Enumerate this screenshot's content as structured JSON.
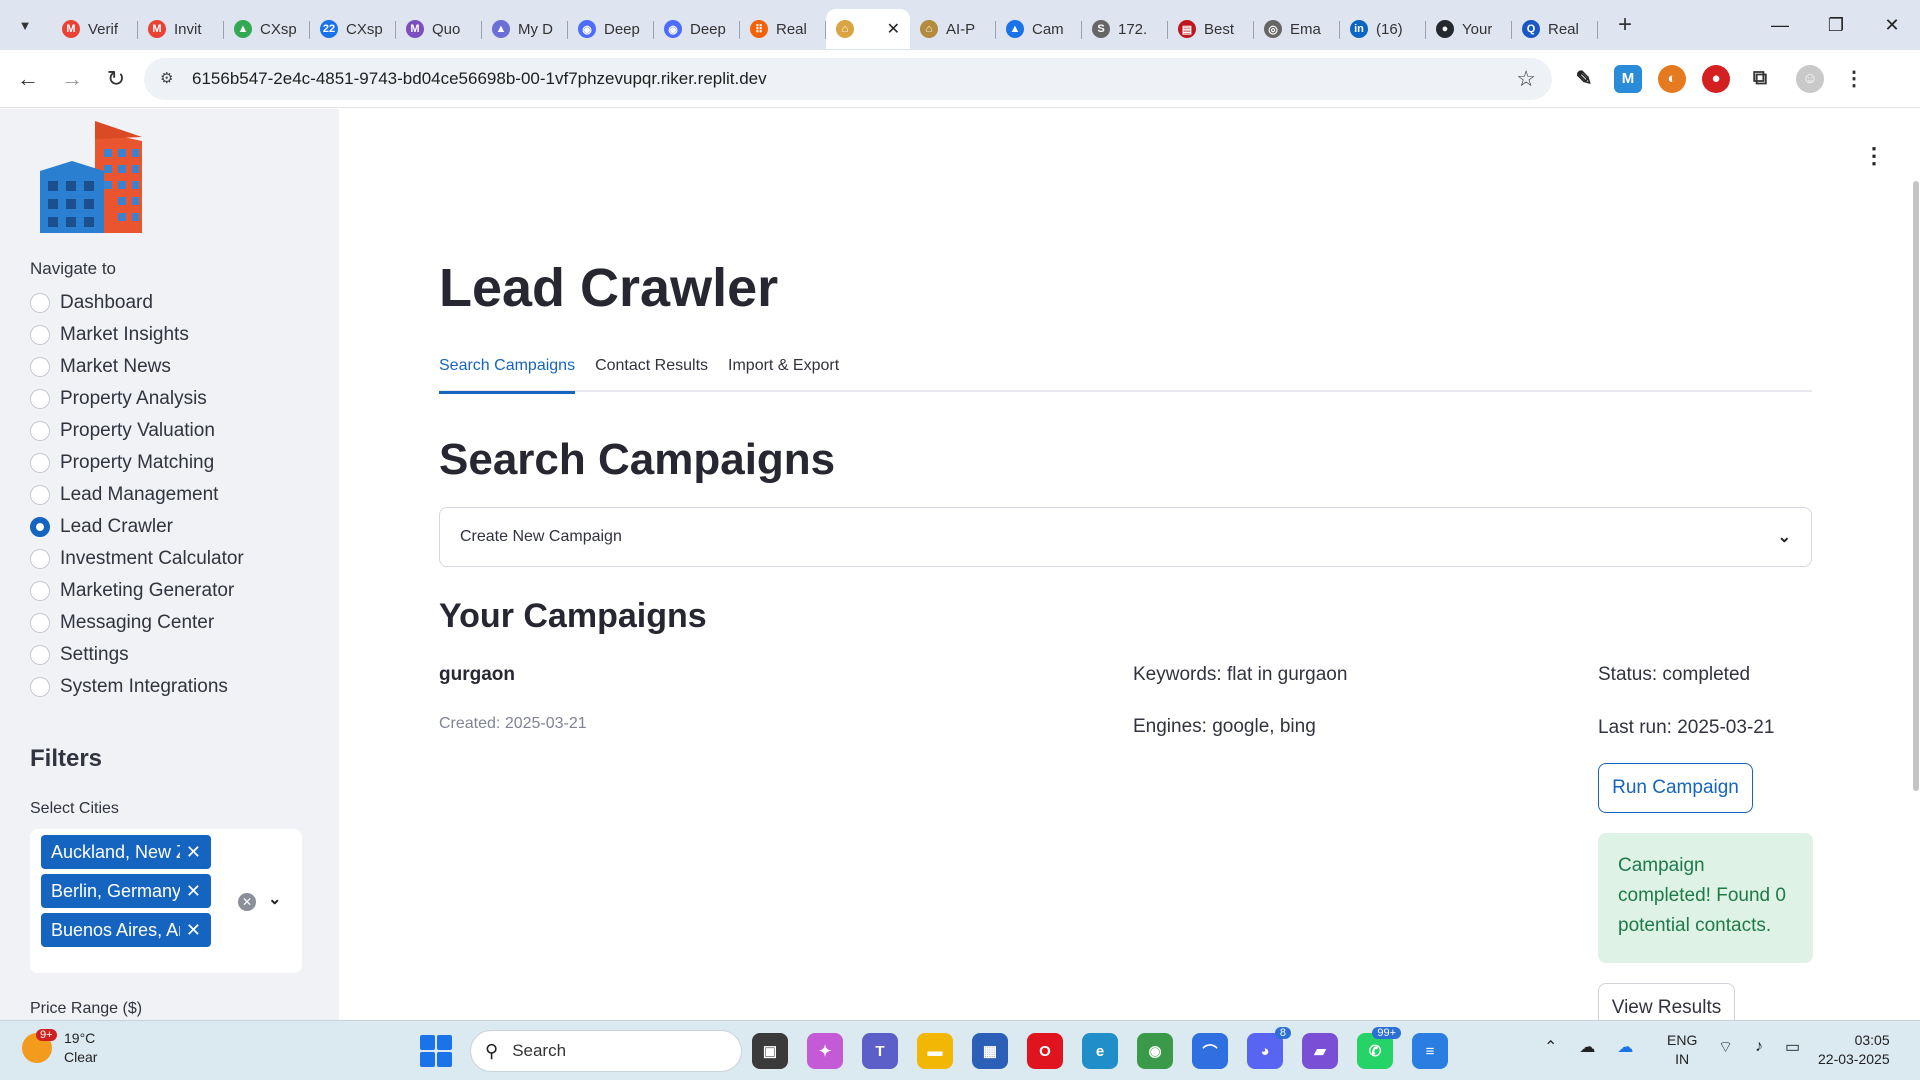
{
  "browser": {
    "tabs": [
      {
        "title": "Verif",
        "icon": "gmail-icon",
        "color": "#ea4335",
        "glyph": "M"
      },
      {
        "title": "Invit",
        "icon": "gmail-icon",
        "color": "#ea4335",
        "glyph": "M"
      },
      {
        "title": "CXsp",
        "icon": "drive-icon",
        "color": "#34a853",
        "glyph": "▲"
      },
      {
        "title": "CXsp",
        "icon": "calendar-icon",
        "color": "#1a73e8",
        "glyph": "22"
      },
      {
        "title": "Quo",
        "icon": "gmail-icon",
        "color": "#7b4fbf",
        "glyph": "M"
      },
      {
        "title": "My D",
        "icon": "drive-icon",
        "color": "#6b6fd6",
        "glyph": "▲"
      },
      {
        "title": "Deep",
        "icon": "deepseek-icon",
        "color": "#4d6bfe",
        "glyph": "◉"
      },
      {
        "title": "Deep",
        "icon": "deepseek-icon",
        "color": "#4d6bfe",
        "glyph": "◉"
      },
      {
        "title": "Real",
        "icon": "replit-icon",
        "color": "#f26207",
        "glyph": "⠿"
      },
      {
        "title": "",
        "icon": "house-icon",
        "color": "#d9a441",
        "glyph": "⌂"
      },
      {
        "title": "AI-P",
        "icon": "house-icon",
        "color": "#b48a3c",
        "glyph": "⌂"
      },
      {
        "title": "Cam",
        "icon": "ads-icon",
        "color": "#1a73e8",
        "glyph": "▲"
      },
      {
        "title": "172.",
        "icon": "globe-icon",
        "color": "#666666",
        "glyph": "S"
      },
      {
        "title": "Best",
        "icon": "news-icon",
        "color": "#c0161d",
        "glyph": "▤"
      },
      {
        "title": "Ema",
        "icon": "globe-icon",
        "color": "#666666",
        "glyph": "◎"
      },
      {
        "title": "(16)",
        "icon": "linkedin-icon",
        "color": "#0a66c2",
        "glyph": "in"
      },
      {
        "title": "Your",
        "icon": "github-icon",
        "color": "#24292f",
        "glyph": "●"
      },
      {
        "title": "Real",
        "icon": "search-engine-icon",
        "color": "#1a57c6",
        "glyph": "Q"
      }
    ],
    "active_tab_index": 9,
    "new_tab": "+",
    "url": "6156b547-2e4c-4851-9743-bd04ce56698b-00-1vf7phzevupqr.riker.replit.dev"
  },
  "sidebar": {
    "nav_label": "Navigate to",
    "nav_items": [
      {
        "label": "Dashboard",
        "selected": false
      },
      {
        "label": "Market Insights",
        "selected": false
      },
      {
        "label": "Market News",
        "selected": false
      },
      {
        "label": "Property Analysis",
        "selected": false
      },
      {
        "label": "Property Valuation",
        "selected": false
      },
      {
        "label": "Property Matching",
        "selected": false
      },
      {
        "label": "Lead Management",
        "selected": false
      },
      {
        "label": "Lead Crawler",
        "selected": true
      },
      {
        "label": "Investment Calculator",
        "selected": false
      },
      {
        "label": "Marketing Generator",
        "selected": false
      },
      {
        "label": "Messaging Center",
        "selected": false
      },
      {
        "label": "Settings",
        "selected": false
      },
      {
        "label": "System Integrations",
        "selected": false
      }
    ],
    "filters_title": "Filters",
    "cities_label": "Select Cities",
    "cities": [
      "Auckland, New Zealand",
      "Berlin, Germany",
      "Buenos Aires, Argentina"
    ],
    "price_label": "Price Range ($)"
  },
  "main": {
    "title": "Lead Crawler",
    "tabs": [
      {
        "label": "Search Campaigns",
        "active": true
      },
      {
        "label": "Contact Results",
        "active": false
      },
      {
        "label": "Import & Export",
        "active": false
      }
    ],
    "section_title": "Search Campaigns",
    "expander_label": "Create New Campaign",
    "your_campaigns_title": "Your Campaigns",
    "campaign": {
      "name": "gurgaon",
      "created": "Created: 2025-03-21",
      "keywords": "Keywords: flat in gurgaon",
      "engines": "Engines: google, bing",
      "status": "Status: completed",
      "last_run": "Last run: 2025-03-21",
      "run_button": "Run Campaign",
      "success_message": "Campaign completed! Found 0 potential contacts.",
      "view_button": "View Results"
    }
  },
  "taskbar": {
    "temperature": "19°C",
    "weather": "Clear",
    "weather_badge": "9+",
    "search_placeholder": "Search",
    "apps": [
      {
        "icon": "task-view-icon",
        "color": "#3a3a3a",
        "glyph": "▣",
        "badge": ""
      },
      {
        "icon": "copilot-icon",
        "color": "#c45ad6",
        "glyph": "✦",
        "badge": ""
      },
      {
        "icon": "teams-icon",
        "color": "#5b5fc7",
        "glyph": "T",
        "badge": ""
      },
      {
        "icon": "file-explorer-icon",
        "color": "#f2b705",
        "glyph": "▬",
        "badge": ""
      },
      {
        "icon": "store-icon",
        "color": "#2b5fb8",
        "glyph": "▦",
        "badge": ""
      },
      {
        "icon": "opera-icon",
        "color": "#e0141e",
        "glyph": "O",
        "badge": ""
      },
      {
        "icon": "edge-icon",
        "color": "#1f8ec9",
        "glyph": "e",
        "badge": ""
      },
      {
        "icon": "chrome-icon",
        "color": "#3b9a4a",
        "glyph": "◉",
        "badge": ""
      },
      {
        "icon": "arc-icon",
        "color": "#2f6fe0",
        "glyph": "⌒",
        "badge": ""
      },
      {
        "icon": "discord-icon",
        "color": "#5865f2",
        "glyph": "◕",
        "badge": "8"
      },
      {
        "icon": "clapper-icon",
        "color": "#7a4fd6",
        "glyph": "▰",
        "badge": ""
      },
      {
        "icon": "whatsapp-icon",
        "color": "#25d366",
        "glyph": "✆",
        "badge": "99+"
      },
      {
        "icon": "notepad-icon",
        "color": "#2a7de1",
        "glyph": "≡",
        "badge": ""
      }
    ],
    "lang_line1": "ENG",
    "lang_line2": "IN",
    "time": "03:05",
    "date": "22-03-2025"
  }
}
